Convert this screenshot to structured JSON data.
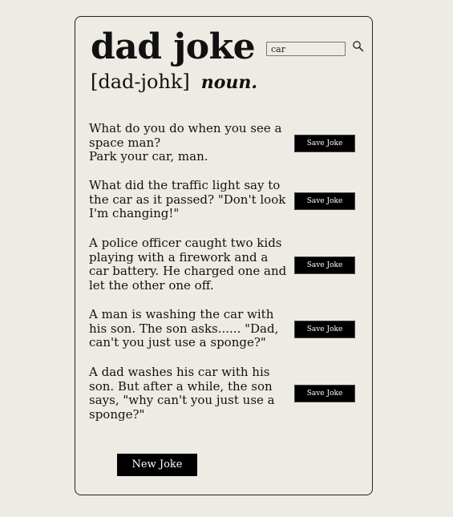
{
  "header": {
    "title": "dad joke",
    "phonetic": "[dad-johk]",
    "part_of_speech": "noun."
  },
  "search": {
    "value": "car",
    "icon": "search-icon"
  },
  "jokes": [
    {
      "text": "What do you do when you see a space man?\nPark your car, man.",
      "save_label": "Save Joke"
    },
    {
      "text": "What did the traffic light say to the car as it passed? \"Don't look I'm changing!\"",
      "save_label": "Save Joke"
    },
    {
      "text": "A police officer caught two kids playing with a firework and a car battery. He charged one and let the other one off.",
      "save_label": "Save Joke"
    },
    {
      "text": "A man is washing the car with his son. The son asks...... \"Dad, can't you just use a sponge?\"",
      "save_label": "Save Joke"
    },
    {
      "text": "A dad washes his car with his son. But after a while, the son says, \"why can't you just use a sponge?\"",
      "save_label": "Save Joke"
    }
  ],
  "new_joke_label": "New Joke"
}
